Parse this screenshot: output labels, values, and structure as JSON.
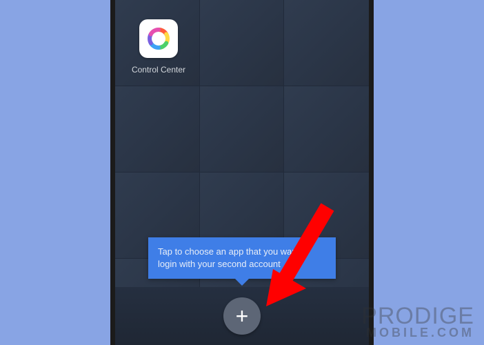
{
  "app": {
    "icons": [
      {
        "label": "Control Center",
        "icon": "color-circle-icon"
      }
    ]
  },
  "tooltip": {
    "text": "Tap to choose an app that you want to login with your second account"
  },
  "add_button": {
    "symbol": "+"
  },
  "watermark": {
    "line1": "PRODIGE",
    "line2": "MOBILE.COM"
  }
}
